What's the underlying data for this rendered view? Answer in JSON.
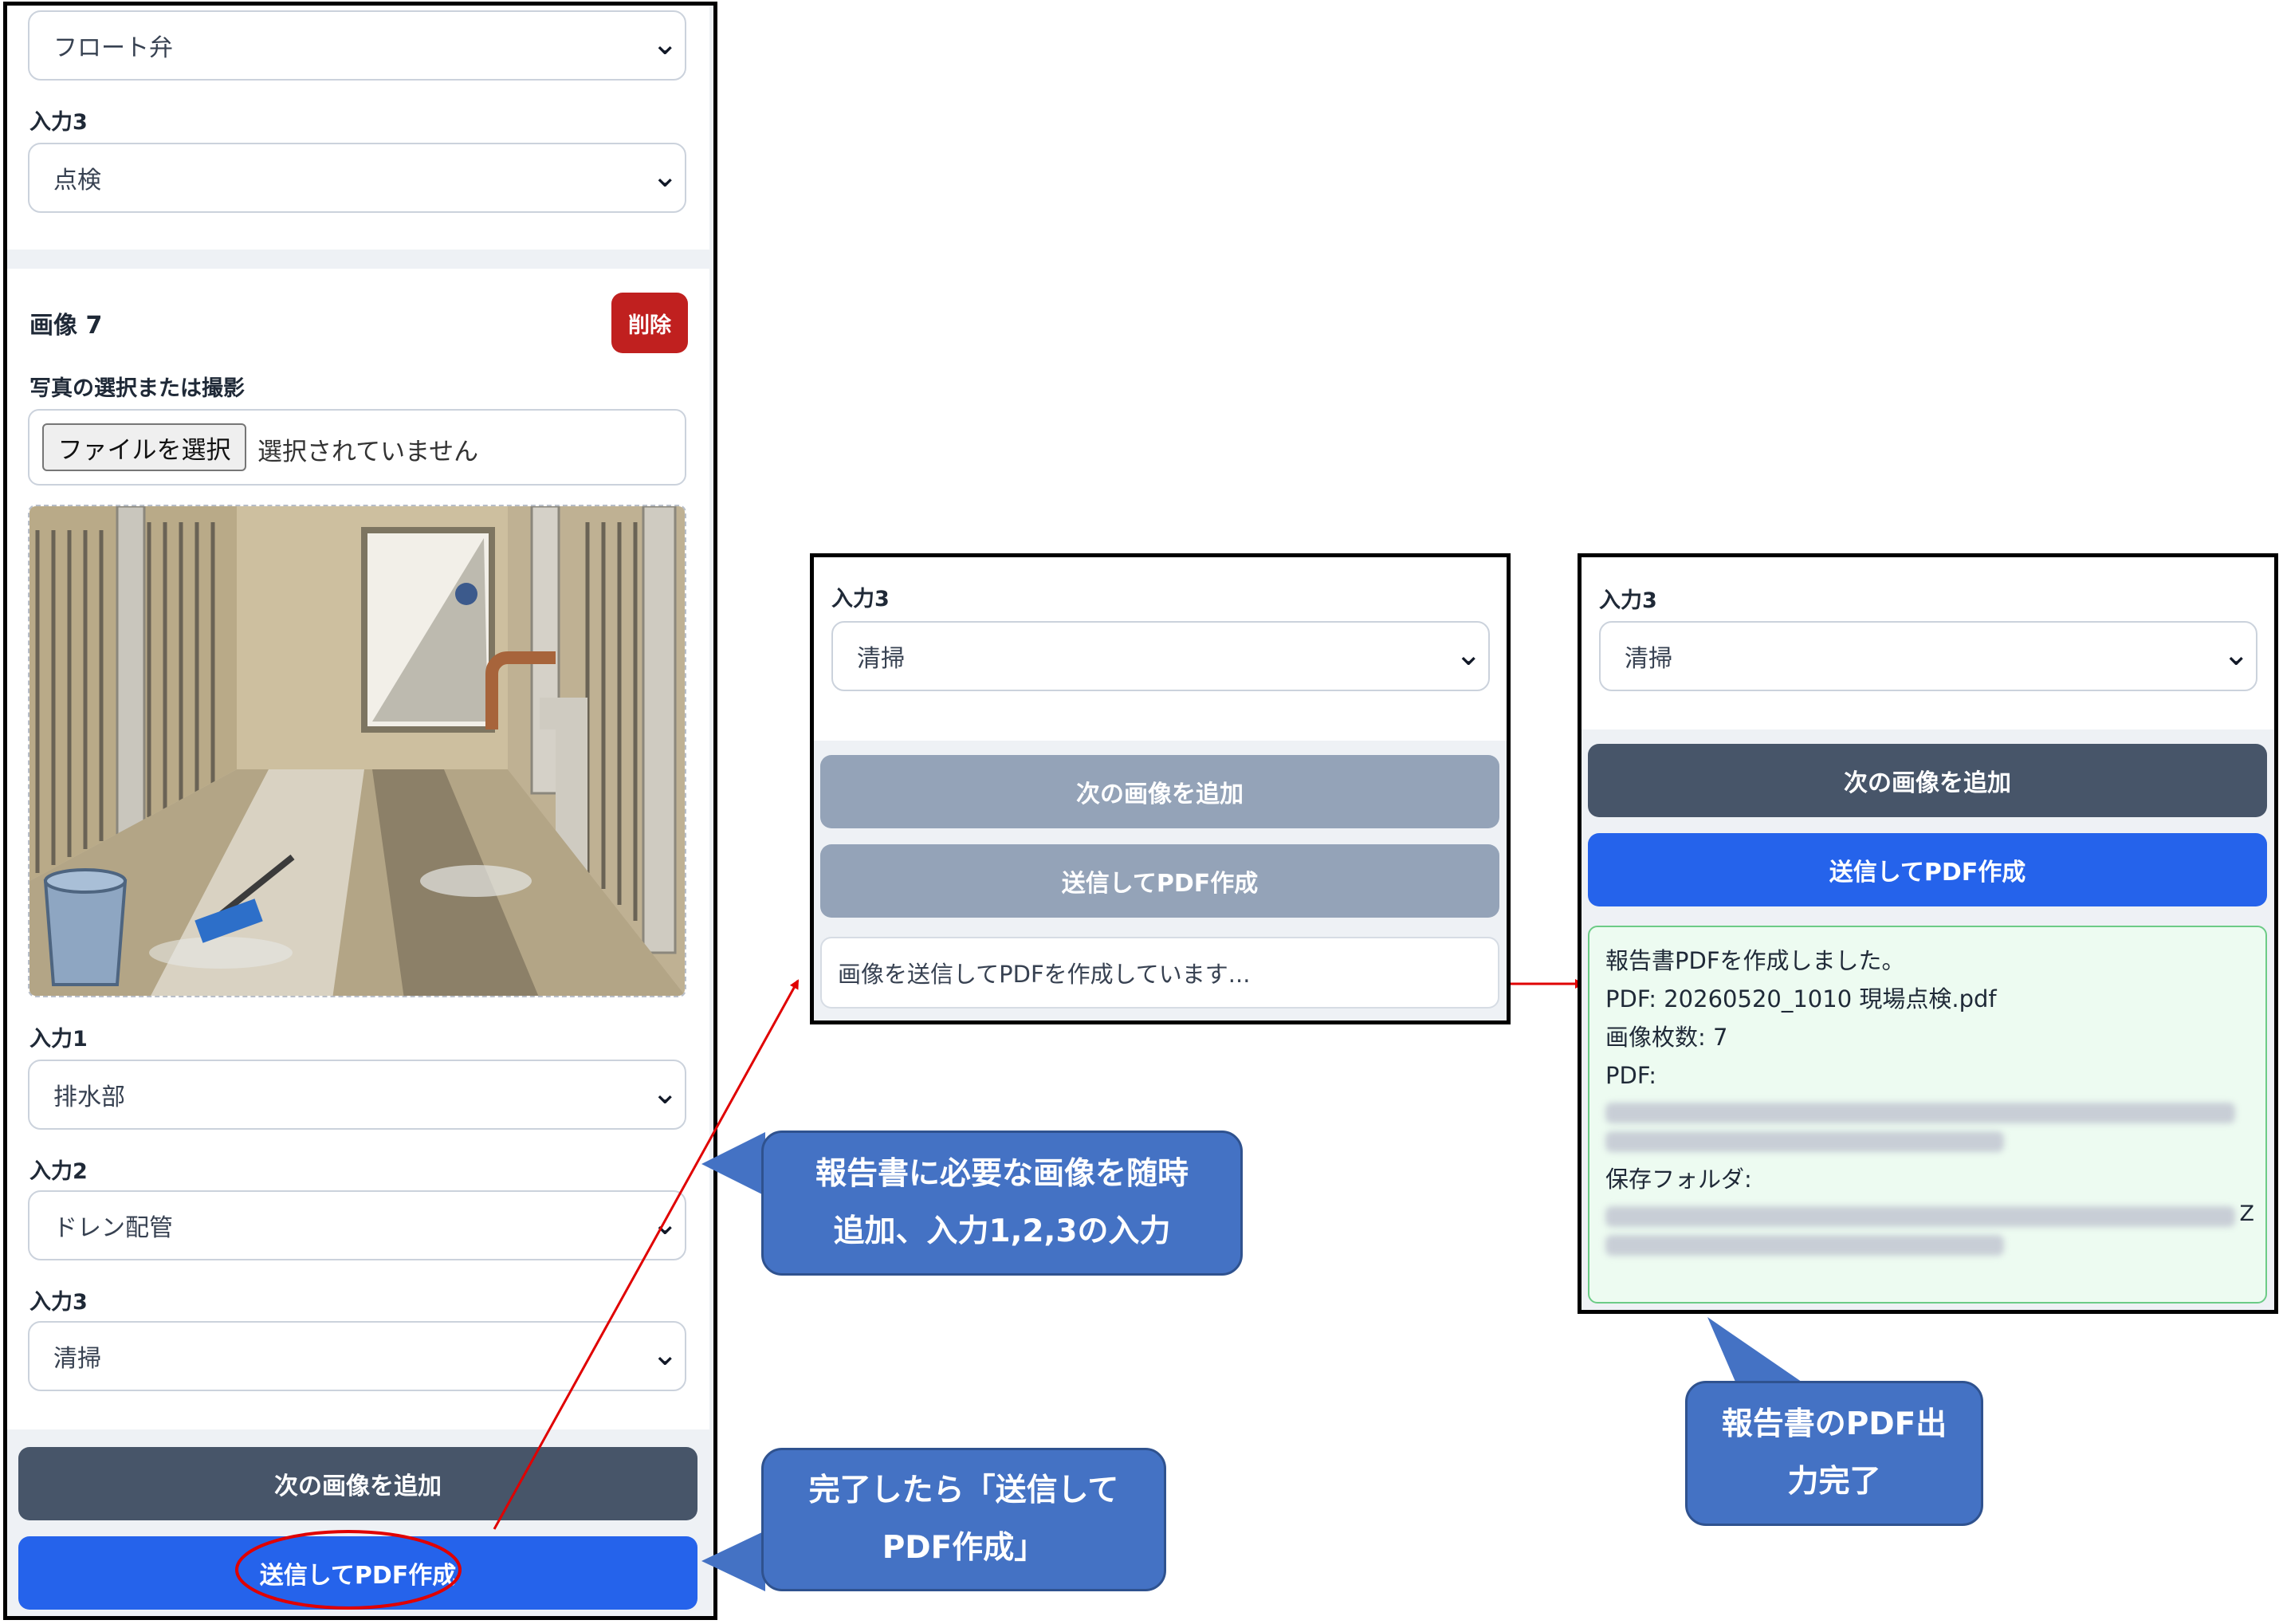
{
  "panel1": {
    "top_select_value": "フロート弁",
    "top_input3_label": "入力3",
    "top_input3_value": "点検",
    "image_title": "画像 7",
    "delete_label": "削除",
    "photo_label": "写真の選択または撮影",
    "file_button_label": "ファイルを選択",
    "file_status": "選択されていません",
    "input1_label": "入力1",
    "input1_value": "排水部",
    "input2_label": "入力2",
    "input2_value": "ドレン配管",
    "input3_label": "入力3",
    "input3_value": "清掃",
    "add_next_label": "次の画像を追加",
    "submit_label": "送信してPDF作成"
  },
  "panel2": {
    "input3_label": "入力3",
    "input3_value": "清掃",
    "add_next_label": "次の画像を追加",
    "submit_label": "送信してPDF作成",
    "status_message": "画像を送信してPDFを作成しています..."
  },
  "panel3": {
    "input3_label": "入力3",
    "input3_value": "清掃",
    "add_next_label": "次の画像を追加",
    "submit_label": "送信してPDF作成",
    "result_line1": "報告書PDFを作成しました。",
    "result_line2": "PDF: 20260520_1010 現場点検.pdf",
    "result_line3": "画像枚数: 7",
    "result_line4": "PDF:",
    "result_line5": "保存フォルダ:",
    "result_trailing_char": "Z"
  },
  "callouts": {
    "add_images_line1": "報告書に必要な画像を随時",
    "add_images_line2": "追加、入力1,2,3の入力",
    "submit_line1": "完了したら「送信して",
    "submit_line2": "PDF作成」",
    "done_line1": "報告書のPDF出",
    "done_line2": "力完了"
  },
  "colors": {
    "primary_blue": "#2563eb",
    "dark_slate": "#475569",
    "disabled_slate": "#94a3b8",
    "danger_red": "#c0201f",
    "callout_blue": "#4472c4",
    "success_green": "#6ccb86",
    "annotation_red": "#e00000"
  },
  "icons": {
    "select_chevron": "chevron-down-icon",
    "illustration": "drainage-channel-illustration"
  }
}
